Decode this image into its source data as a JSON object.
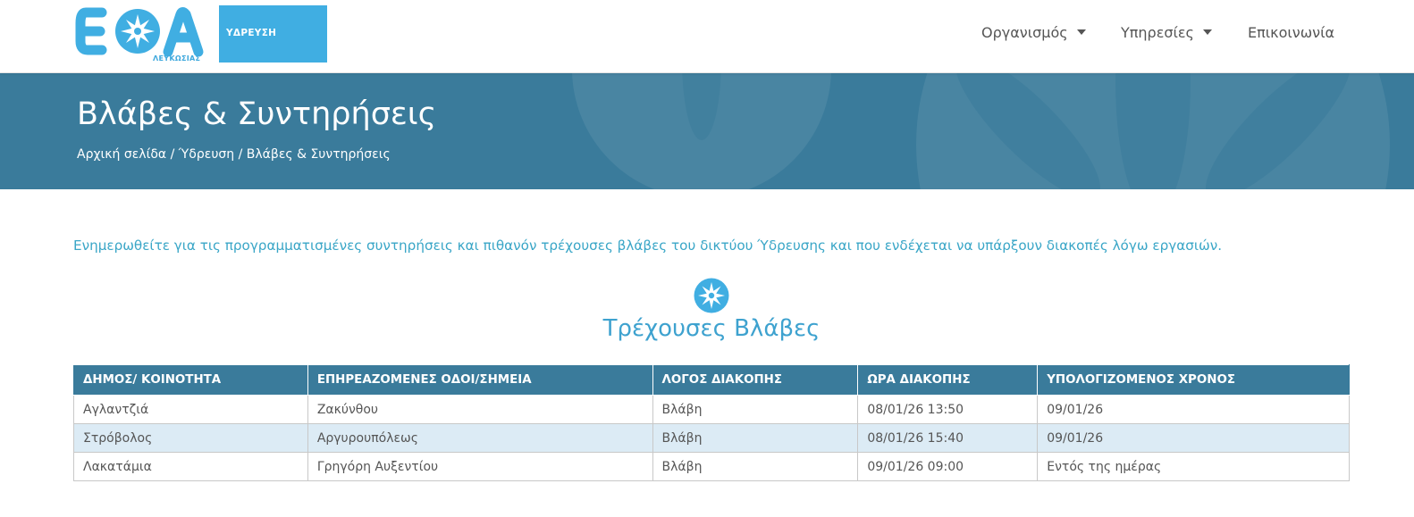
{
  "header": {
    "logo": {
      "text": "ΕΟΑ",
      "subtitle": "ΛΕΥΚΩΣΙΑΣ",
      "badge": "ΥΔΡΕΥΣΗ"
    },
    "nav": [
      {
        "label": "Οργανισμός",
        "has_dropdown": true
      },
      {
        "label": "Υπηρεσίες",
        "has_dropdown": true
      },
      {
        "label": "Επικοινωνία",
        "has_dropdown": false
      }
    ]
  },
  "banner": {
    "title": "Βλάβες & Συντηρήσεις",
    "breadcrumb": {
      "home": "Αρχική σελίδα",
      "sep1": " / ",
      "section": "Ύδρευση",
      "sep2": " / ",
      "current": "Βλάβες & Συντηρήσεις"
    }
  },
  "intro_text": "Ενημερωθείτε για τις προγραμματισμένες συντηρήσεις και πιθανόν τρέχουσες βλάβες του δικτύου Ύδρευσης και που ενδέχεται να υπάρξουν διακοπές λόγω εργασιών.",
  "section_title": "Τρέχουσες Βλάβες",
  "table": {
    "headers": [
      "ΔΗΜΟΣ/ ΚΟΙΝΟΤΗΤΑ",
      "ΕΠΗΡΕΑΖΟΜΕΝΕΣ ΟΔΟΙ/ΣΗΜΕΙΑ",
      "ΛΟΓΟΣ ΔΙΑΚΟΠΗΣ",
      "ΩΡΑ ΔΙΑΚΟΠΗΣ",
      "ΥΠΟΛΟΓΙΖΟΜΕΝΟΣ ΧΡΟΝΟΣ"
    ],
    "rows": [
      [
        "Αγλαντζιά",
        "Ζακύνθου",
        "Βλάβη",
        "08/01/26 13:50",
        "09/01/26"
      ],
      [
        "Στρόβολος",
        "Αργυρουπόλεως",
        "Βλάβη",
        "08/01/26 15:40",
        "09/01/26"
      ],
      [
        "Λακατάμια",
        "Γρηγόρη Αυξεντίου",
        "Βλάβη",
        "09/01/26 09:00",
        "Εντός της ημέρας"
      ]
    ]
  },
  "colors": {
    "brand_blue": "#40aee2",
    "banner_bg": "#3a7b9b",
    "table_header_bg": "#3a7b9b",
    "alt_row_bg": "#dcebf5",
    "intro_text": "#3aa6c7"
  },
  "icons": {
    "logo_star": "compass-star-icon",
    "section_star": "compass-star-icon",
    "dropdown": "caret-down-icon"
  }
}
